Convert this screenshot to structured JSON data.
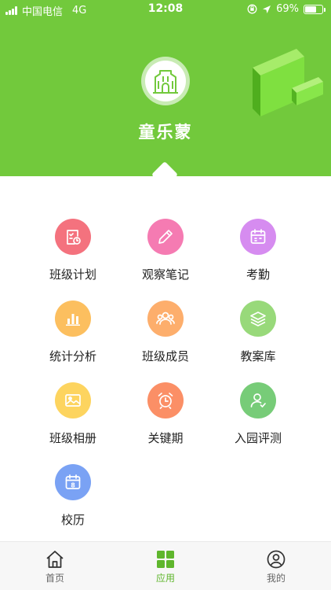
{
  "status_bar": {
    "carrier": "中国电信",
    "network": "4G",
    "time": "12:08",
    "battery": "69%",
    "battery_level": 0.69
  },
  "header": {
    "school_name": "童乐蒙",
    "background_color": "#72c93c",
    "logo_icon": "school-building-icon"
  },
  "apps": [
    {
      "label": "班级计划",
      "icon": "checklist-clock-icon",
      "color": "#f4727e"
    },
    {
      "label": "观察笔记",
      "icon": "pencil-icon",
      "color": "#f57bb2"
    },
    {
      "label": "考勤",
      "icon": "calendar-icon",
      "color": "#d68cf0"
    },
    {
      "label": "统计分析",
      "icon": "bar-chart-icon",
      "color": "#fcbf5f"
    },
    {
      "label": "班级成员",
      "icon": "people-icon",
      "color": "#fdae6c"
    },
    {
      "label": "教案库",
      "icon": "layers-icon",
      "color": "#98d97a"
    },
    {
      "label": "班级相册",
      "icon": "image-icon",
      "color": "#fdd45f"
    },
    {
      "label": "关键期",
      "icon": "alarm-clock-icon",
      "color": "#fb8f66"
    },
    {
      "label": "入园评测",
      "icon": "user-check-icon",
      "color": "#77cc78"
    },
    {
      "label": "校历",
      "icon": "calendar-8-icon",
      "color": "#7aa2f4"
    }
  ],
  "tabbar": {
    "items": [
      {
        "label": "首页",
        "icon": "home-icon",
        "active": false
      },
      {
        "label": "应用",
        "icon": "grid-icon",
        "active": true
      },
      {
        "label": "我的",
        "icon": "user-circle-icon",
        "active": false
      }
    ],
    "active_color": "#5fb62d"
  }
}
